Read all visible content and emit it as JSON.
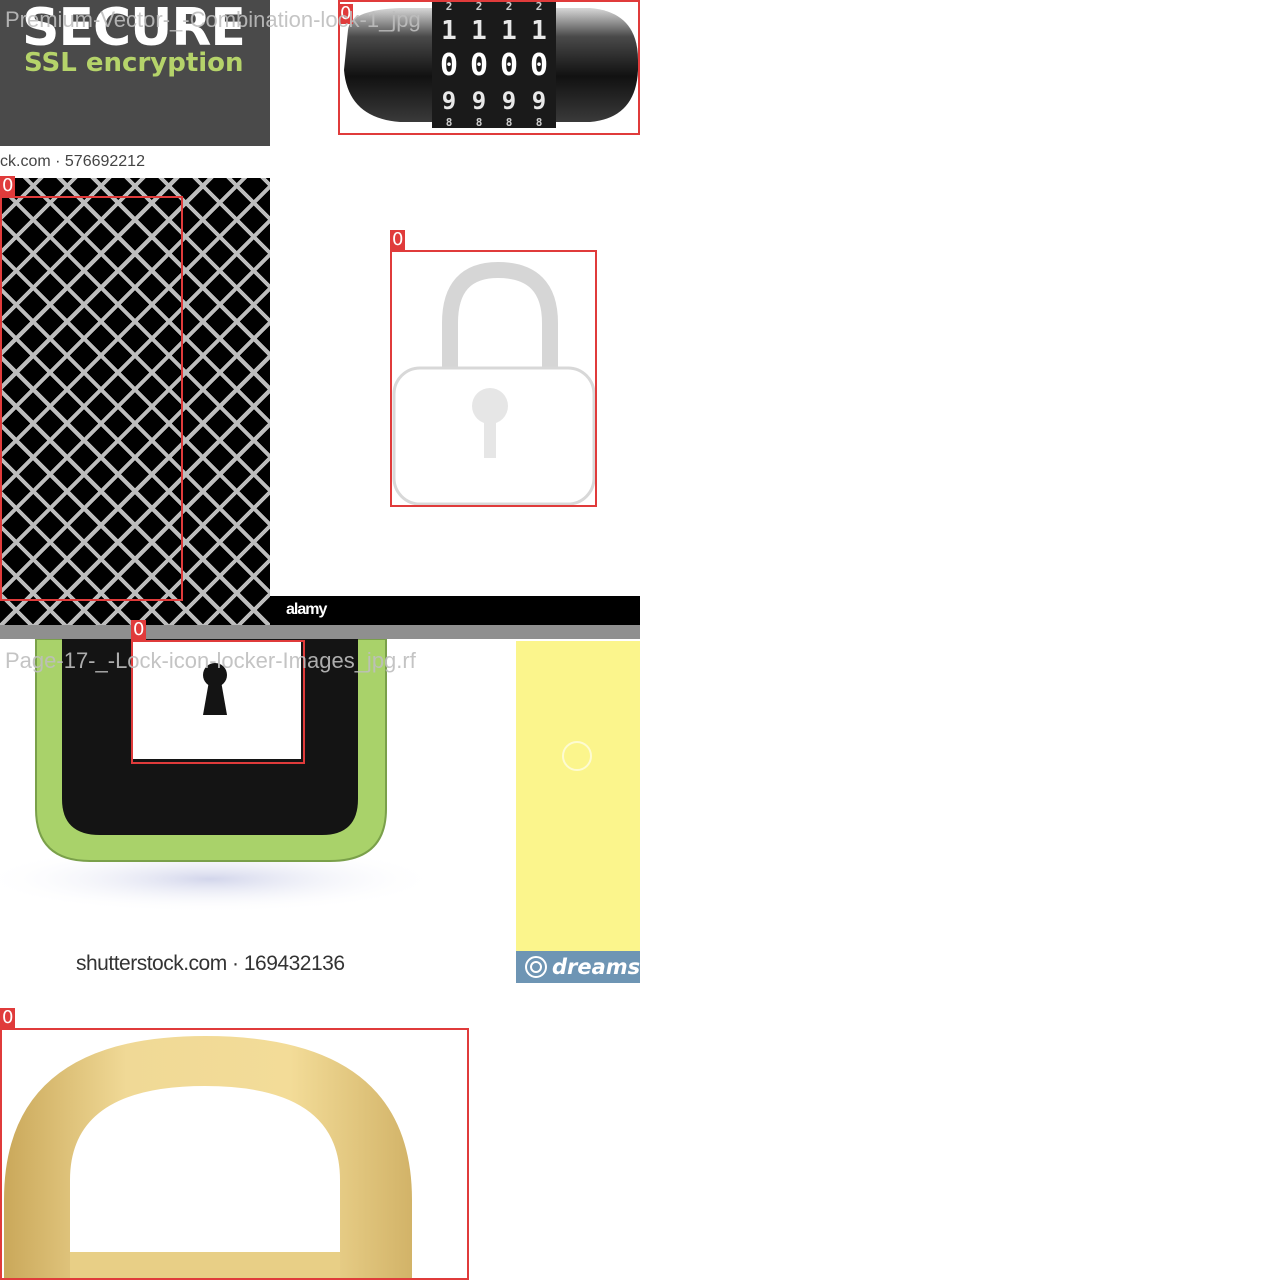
{
  "mosaic": {
    "captions": {
      "top_left": "Premium-Vector-_-Combination-lock-1_jpg",
      "middle_left": "Page-17-_-Lock-icon-locker-Images_jpg.rf"
    },
    "box_tag": "0",
    "secure_tile": {
      "headline": "SECURE",
      "subline": "SSL encryption"
    },
    "combination_lock": {
      "rows": [
        [
          "2",
          "2",
          "2",
          "2"
        ],
        [
          "1",
          "1",
          "1",
          "1"
        ],
        [
          "0",
          "0",
          "0",
          "0"
        ],
        [
          "9",
          "9",
          "9",
          "9"
        ],
        [
          "8",
          "8",
          "8",
          "8"
        ]
      ]
    },
    "watermarks": {
      "shutterstock_top": "ck.com · 576692212",
      "alamy": "alamy",
      "shutterstock_bottom": "shutterstock.com · 169432136",
      "dreamstime": "dreamsti"
    },
    "colors": {
      "box": "#e03b3b",
      "secure_bg": "#4a4a4a",
      "secure_green": "#b5d36a",
      "green_rim": "#a9d26a",
      "yellow_tile": "#fbf58c",
      "gold_shackle": "#e8cf86"
    }
  }
}
